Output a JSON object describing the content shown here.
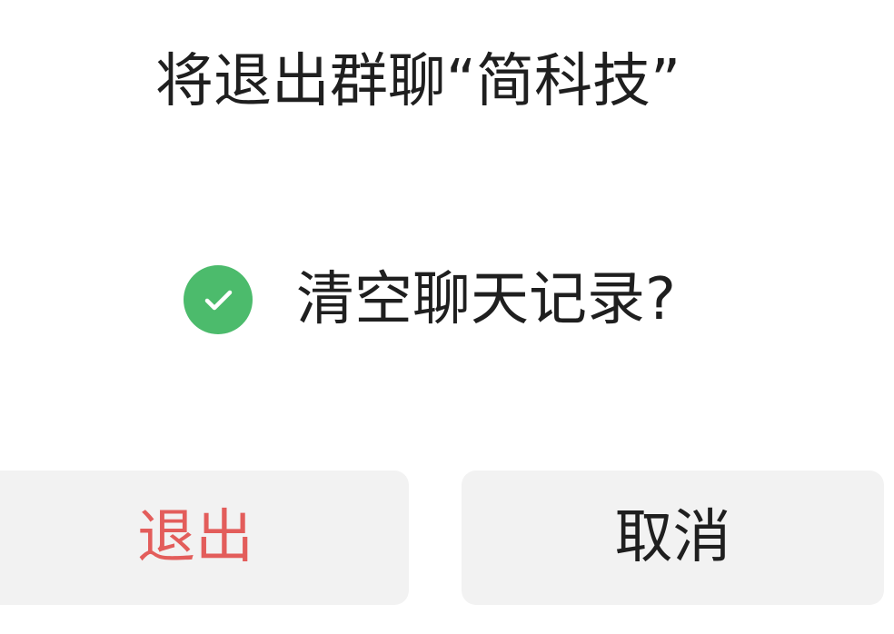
{
  "dialog": {
    "title": "将退出群聊“简科技”",
    "option": {
      "label": "清空聊天记录?",
      "checked": true,
      "icon": "check-circle-icon"
    },
    "buttons": {
      "exit_label": "退出",
      "cancel_label": "取消"
    }
  },
  "colors": {
    "check_green": "#4cbb6c",
    "exit_red": "#e35d5b",
    "button_bg": "#f2f2f2",
    "text": "#1f1f1f"
  }
}
